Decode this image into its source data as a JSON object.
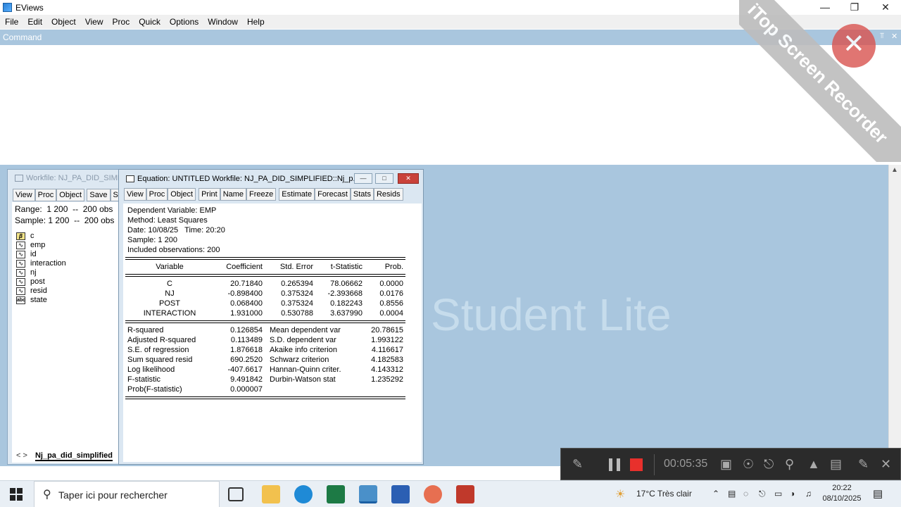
{
  "app": {
    "title": "EViews"
  },
  "window_controls": {
    "minimize": "—",
    "restore": "❐",
    "close": "✕"
  },
  "menu": [
    "File",
    "Edit",
    "Object",
    "View",
    "Proc",
    "Quick",
    "Options",
    "Window",
    "Help"
  ],
  "command": {
    "label": "Command",
    "pin": "⫪",
    "close": "✕"
  },
  "watermark": "Student Lite",
  "workfile": {
    "title": "Workfile: NJ_PA_DID_SIMPLIFIED",
    "toolbar": [
      "View",
      "Proc",
      "Object",
      "Save",
      "Snap"
    ],
    "range_label": "Range:",
    "range_value": "1 200  --  200 obs",
    "sample_label": "Sample:",
    "sample_value": "1 200  --  200 obs",
    "objects": [
      {
        "name": "c",
        "type": "coef"
      },
      {
        "name": "emp",
        "type": "series"
      },
      {
        "name": "id",
        "type": "series"
      },
      {
        "name": "interaction",
        "type": "series"
      },
      {
        "name": "nj",
        "type": "series"
      },
      {
        "name": "post",
        "type": "series"
      },
      {
        "name": "resid",
        "type": "series"
      },
      {
        "name": "state",
        "type": "alpha"
      }
    ],
    "tab": "Nj_pa_did_simplified",
    "nav": "< >"
  },
  "equation": {
    "title": "Equation: UNTITLED   Workfile: NJ_PA_DID_SIMPLIFIED::Nj_p...",
    "toolbar_left": [
      "View",
      "Proc",
      "Object"
    ],
    "toolbar_mid": [
      "Print",
      "Name",
      "Freeze"
    ],
    "toolbar_right": [
      "Estimate",
      "Forecast",
      "Stats",
      "Resids"
    ],
    "header": [
      "Dependent Variable: EMP",
      "Method: Least Squares",
      "Date: 10/08/25   Time: 20:20",
      "Sample: 1 200",
      "Included observations: 200"
    ],
    "columns": [
      "Variable",
      "Coefficient",
      "Std. Error",
      "t-Statistic",
      "Prob."
    ],
    "rows": [
      [
        "C",
        "20.71840",
        "0.265394",
        "78.06662",
        "0.0000"
      ],
      [
        "NJ",
        "-0.898400",
        "0.375324",
        "-2.393668",
        "0.0176"
      ],
      [
        "POST",
        "0.068400",
        "0.375324",
        "0.182243",
        "0.8556"
      ],
      [
        "INTERACTION",
        "1.931000",
        "0.530788",
        "3.637990",
        "0.0004"
      ]
    ],
    "stats": [
      [
        "R-squared",
        "0.126854",
        "Mean dependent var",
        "20.78615"
      ],
      [
        "Adjusted R-squared",
        "0.113489",
        "S.D. dependent var",
        "1.993122"
      ],
      [
        "S.E. of regression",
        "1.876618",
        "Akaike info criterion",
        "4.116617"
      ],
      [
        "Sum squared resid",
        "690.2520",
        "Schwarz criterion",
        "4.182583"
      ],
      [
        "Log likelihood",
        "-407.6617",
        "Hannan-Quinn criter.",
        "4.143312"
      ],
      [
        "F-statistic",
        "9.491842",
        "Durbin-Watson stat",
        "1.235292"
      ],
      [
        "Prob(F-statistic)",
        "0.000007",
        "",
        ""
      ]
    ]
  },
  "recorder": {
    "brand": "iTop Screen Recorder",
    "timer": "00:05:35"
  },
  "taskbar": {
    "search_placeholder": "Taper ici pour rechercher",
    "weather": "17°C  Très clair",
    "time": "20:22",
    "date": "08/10/2025"
  }
}
